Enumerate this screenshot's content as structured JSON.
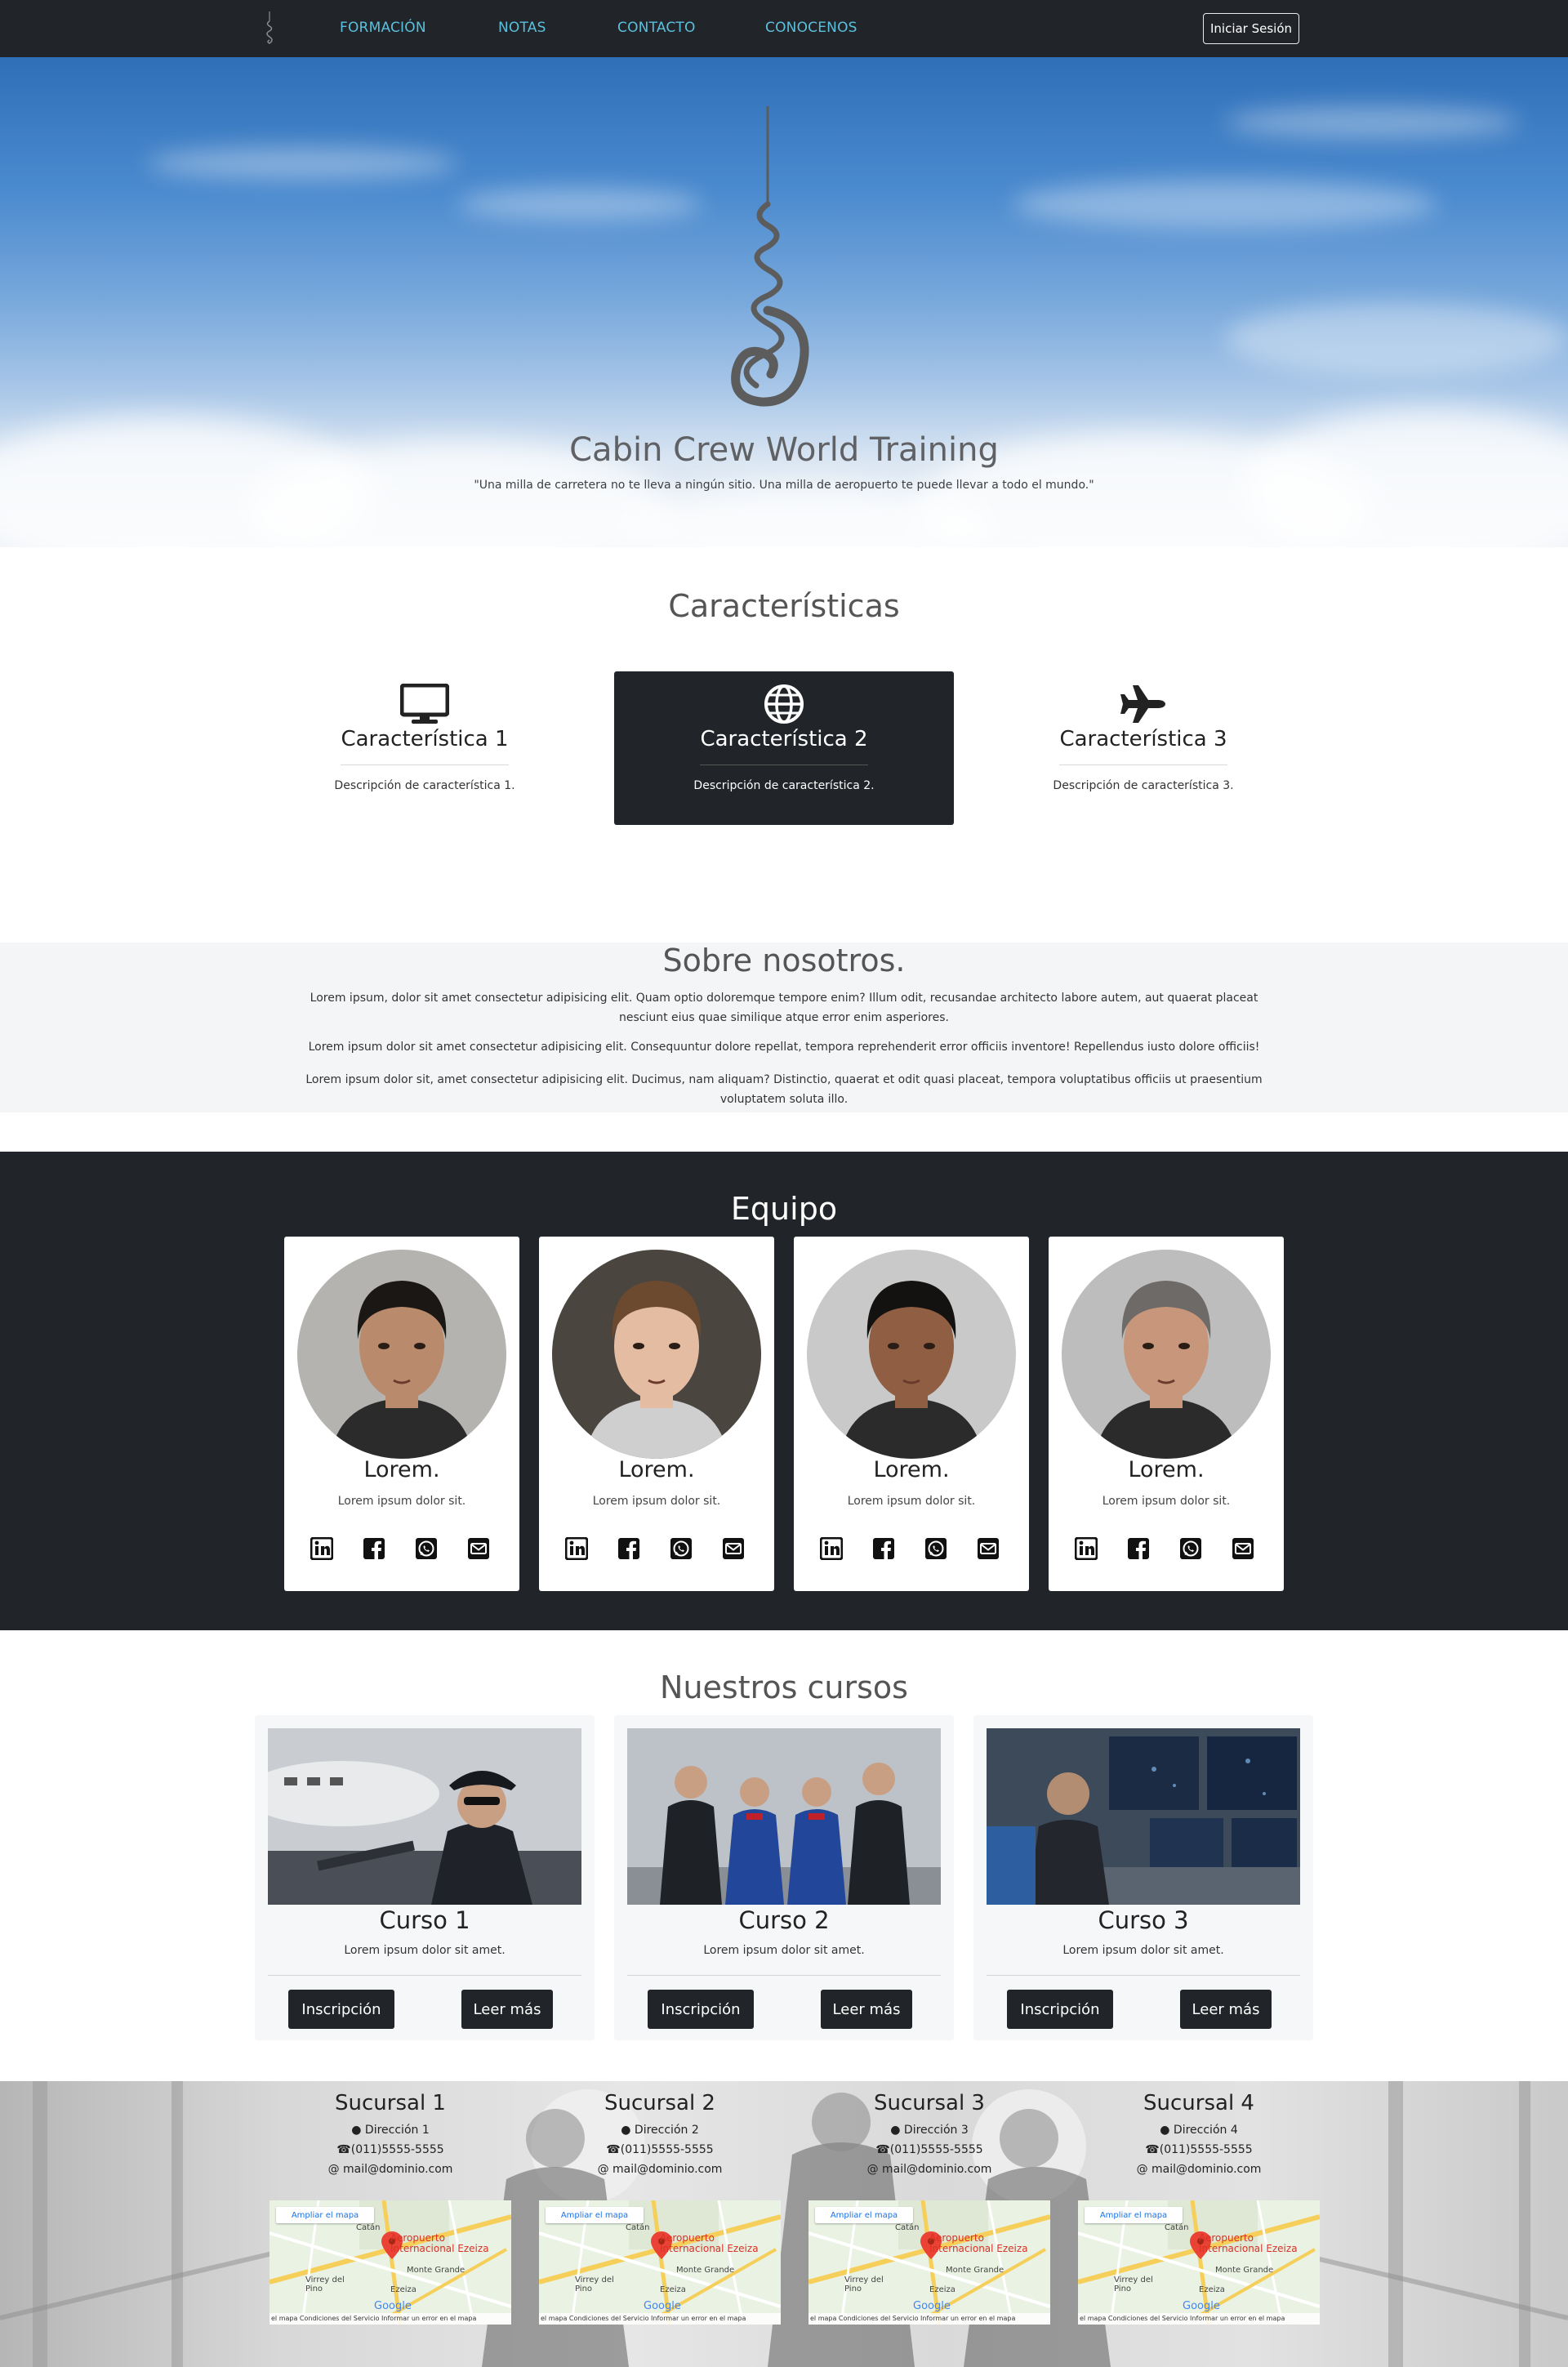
{
  "nav": {
    "links": [
      "FORMACIÓN",
      "NOTAS",
      "CONTACTO",
      "CONOCENOS"
    ],
    "login_label": "Iniciar Sesión"
  },
  "hero": {
    "title": "Cabin Crew World Training",
    "quote": "\"Una milla de carretera no te lleva a ningún sitio. Una milla de aeropuerto te puede llevar a todo el mundo.\""
  },
  "features": {
    "title": "Características",
    "items": [
      {
        "title": "Característica 1",
        "description": "Descripción de característica 1.",
        "icon": "monitor-icon"
      },
      {
        "title": "Característica 2",
        "description": "Descripción de característica 2.",
        "icon": "globe-icon"
      },
      {
        "title": "Característica 3",
        "description": "Descripción de característica 3.",
        "icon": "airplane-icon"
      }
    ]
  },
  "about": {
    "title": "Sobre nosotros.",
    "paragraphs": [
      "Lorem ipsum, dolor sit amet consectetur adipisicing elit. Quam optio doloremque tempore enim? Illum odit, recusandae architecto labore autem, aut quaerat placeat nesciunt eius quae similique atque error enim asperiores.",
      "Lorem ipsum dolor sit amet consectetur adipisicing elit. Consequuntur dolore repellat, tempora reprehenderit error officiis inventore! Repellendus iusto dolore officiis!",
      "Lorem ipsum dolor sit, amet consectetur adipisicing elit. Ducimus, nam aliquam? Distinctio, quaerat et odit quasi placeat, tempora voluptatibus officiis ut praesentium voluptatem soluta illo."
    ]
  },
  "team": {
    "title": "Equipo",
    "members": [
      {
        "name": "Lorem.",
        "description": "Lorem ipsum dolor sit."
      },
      {
        "name": "Lorem.",
        "description": "Lorem ipsum dolor sit."
      },
      {
        "name": "Lorem.",
        "description": "Lorem ipsum dolor sit."
      },
      {
        "name": "Lorem.",
        "description": "Lorem ipsum dolor sit."
      }
    ],
    "social_icons": [
      "linkedin-icon",
      "facebook-icon",
      "whatsapp-icon",
      "email-icon"
    ]
  },
  "courses": {
    "title": "Nuestros cursos",
    "items": [
      {
        "title": "Curso 1",
        "description": "Lorem ipsum dolor sit amet.",
        "primary": "Inscripción",
        "secondary": "Leer más"
      },
      {
        "title": "Curso 2",
        "description": "Lorem ipsum dolor sit amet.",
        "primary": "Inscripción",
        "secondary": "Leer más"
      },
      {
        "title": "Curso 3",
        "description": "Lorem ipsum dolor sit amet.",
        "primary": "Inscripción",
        "secondary": "Leer más"
      }
    ]
  },
  "branches": [
    {
      "title": "Sucursal 1",
      "address": "Dirección 1",
      "phone": "(011)5555-5555",
      "email": "mail@dominio.com"
    },
    {
      "title": "Sucursal 2",
      "address": "Dirección 2",
      "phone": "(011)5555-5555",
      "email": "mail@dominio.com"
    },
    {
      "title": "Sucursal 3",
      "address": "Dirección 3",
      "phone": "(011)5555-5555",
      "email": "mail@dominio.com"
    },
    {
      "title": "Sucursal 4",
      "address": "Dirección 4",
      "phone": "(011)5555-5555",
      "email": "mail@dominio.com"
    }
  ],
  "map": {
    "expand_label": "Ampliar el mapa",
    "place_label": "Aeropuerto Internacional Ezeiza",
    "town_1": "Monte Grande",
    "town_2": "Virrey del Pino",
    "town_3": "Ezeiza",
    "town_4": "Catán",
    "brand": "Google",
    "footer": "el mapa   Condiciones del Servicio   Informar un error en el mapa"
  },
  "colors": {
    "nav_bg": "#212529",
    "nav_link": "#5bc0de",
    "dark": "#212529",
    "section_light": "#f4f5f7"
  }
}
